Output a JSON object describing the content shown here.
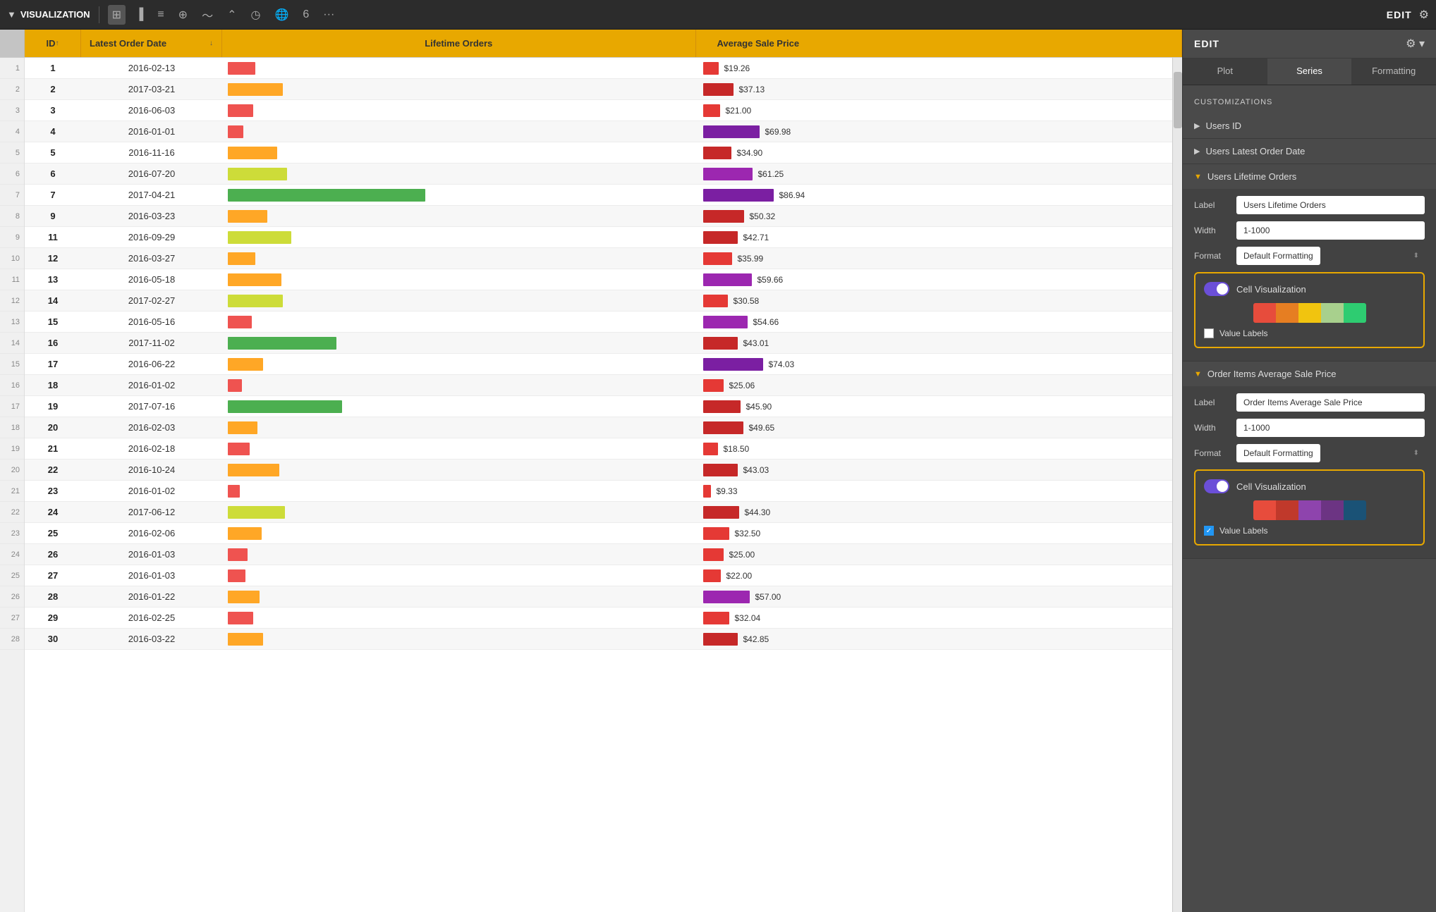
{
  "toolbar": {
    "title": "VISUALIZATION",
    "icons": [
      "▼",
      "⊞",
      "📊",
      "≡",
      "◉",
      "〜",
      "⌃",
      "🌐",
      "6",
      "···"
    ],
    "edit_label": "EDIT"
  },
  "tabs": {
    "plot": "Plot",
    "series": "Series",
    "formatting": "Formatting"
  },
  "table": {
    "headers": {
      "id": "ID",
      "date": "Latest Order Date",
      "orders": "Lifetime Orders",
      "price": "Average Sale Price"
    },
    "rows": [
      {
        "row": 1,
        "id": "1",
        "date": "2016-02-13",
        "orders": 14,
        "price": "$19.26",
        "price_val": 19.26
      },
      {
        "row": 2,
        "id": "2",
        "date": "2017-03-21",
        "orders": 28,
        "price": "$37.13",
        "price_val": 37.13
      },
      {
        "row": 3,
        "id": "3",
        "date": "2016-06-03",
        "orders": 13,
        "price": "$21.00",
        "price_val": 21.0
      },
      {
        "row": 4,
        "id": "4",
        "date": "2016-01-01",
        "orders": 8,
        "price": "$69.98",
        "price_val": 69.98
      },
      {
        "row": 5,
        "id": "5",
        "date": "2016-11-16",
        "orders": 25,
        "price": "$34.90",
        "price_val": 34.9
      },
      {
        "row": 6,
        "id": "6",
        "date": "2016-07-20",
        "orders": 30,
        "price": "$61.25",
        "price_val": 61.25
      },
      {
        "row": 7,
        "id": "7",
        "date": "2017-04-21",
        "orders": 100,
        "price": "$86.94",
        "price_val": 86.94
      },
      {
        "row": 8,
        "id": "9",
        "date": "2016-03-23",
        "orders": 20,
        "price": "$50.32",
        "price_val": 50.32
      },
      {
        "row": 9,
        "id": "11",
        "date": "2016-09-29",
        "orders": 32,
        "price": "$42.71",
        "price_val": 42.71
      },
      {
        "row": 10,
        "id": "12",
        "date": "2016-03-27",
        "orders": 14,
        "price": "$35.99",
        "price_val": 35.99
      },
      {
        "row": 11,
        "id": "13",
        "date": "2016-05-18",
        "orders": 27,
        "price": "$59.66",
        "price_val": 59.66
      },
      {
        "row": 12,
        "id": "14",
        "date": "2017-02-27",
        "orders": 28,
        "price": "$30.58",
        "price_val": 30.58
      },
      {
        "row": 13,
        "id": "15",
        "date": "2016-05-16",
        "orders": 12,
        "price": "$54.66",
        "price_val": 54.66
      },
      {
        "row": 14,
        "id": "16",
        "date": "2017-11-02",
        "orders": 55,
        "price": "$43.01",
        "price_val": 43.01
      },
      {
        "row": 15,
        "id": "17",
        "date": "2016-06-22",
        "orders": 18,
        "price": "$74.03",
        "price_val": 74.03
      },
      {
        "row": 16,
        "id": "18",
        "date": "2016-01-02",
        "orders": 7,
        "price": "$25.06",
        "price_val": 25.06
      },
      {
        "row": 17,
        "id": "19",
        "date": "2017-07-16",
        "orders": 58,
        "price": "$45.90",
        "price_val": 45.9
      },
      {
        "row": 18,
        "id": "20",
        "date": "2016-02-03",
        "orders": 15,
        "price": "$49.65",
        "price_val": 49.65
      },
      {
        "row": 19,
        "id": "21",
        "date": "2016-02-18",
        "orders": 11,
        "price": "$18.50",
        "price_val": 18.5
      },
      {
        "row": 20,
        "id": "22",
        "date": "2016-10-24",
        "orders": 26,
        "price": "$43.03",
        "price_val": 43.03
      },
      {
        "row": 21,
        "id": "23",
        "date": "2016-01-02",
        "orders": 6,
        "price": "$9.33",
        "price_val": 9.33
      },
      {
        "row": 22,
        "id": "24",
        "date": "2017-06-12",
        "orders": 29,
        "price": "$44.30",
        "price_val": 44.3
      },
      {
        "row": 23,
        "id": "25",
        "date": "2016-02-06",
        "orders": 17,
        "price": "$32.50",
        "price_val": 32.5
      },
      {
        "row": 24,
        "id": "26",
        "date": "2016-01-03",
        "orders": 10,
        "price": "$25.00",
        "price_val": 25.0
      },
      {
        "row": 25,
        "id": "27",
        "date": "2016-01-03",
        "orders": 9,
        "price": "$22.00",
        "price_val": 22.0
      },
      {
        "row": 26,
        "id": "28",
        "date": "2016-01-22",
        "orders": 16,
        "price": "$57.00",
        "price_val": 57.0
      },
      {
        "row": 27,
        "id": "29",
        "date": "2016-02-25",
        "orders": 13,
        "price": "$32.04",
        "price_val": 32.04
      },
      {
        "row": 28,
        "id": "30",
        "date": "2016-03-22",
        "orders": 18,
        "price": "$42.85",
        "price_val": 42.85
      }
    ]
  },
  "right_panel": {
    "edit_label": "EDIT",
    "customizations_label": "CUSTOMIZATIONS",
    "items": [
      {
        "id": "users-id",
        "title": "Users ID",
        "expanded": false
      },
      {
        "id": "users-latest",
        "title": "Users Latest Order Date",
        "expanded": false
      },
      {
        "id": "users-lifetime",
        "title": "Users Lifetime Orders",
        "expanded": true
      },
      {
        "id": "order-items",
        "title": "Order Items Average Sale Price",
        "expanded": true
      }
    ],
    "lifetime_orders": {
      "label_field": "Users Lifetime Orders",
      "width_field": "1-1000",
      "format_field": "Default Formatting",
      "cell_viz_label": "Cell Visualization",
      "value_labels": "Value Labels",
      "colors": [
        "#e74c3c",
        "#e67e22",
        "#f1c40f",
        "#a8d08d",
        "#2ecc71"
      ],
      "value_labels_checked": false
    },
    "avg_sale_price": {
      "label_field": "Order Items Average Sale Price",
      "width_field": "1-1000",
      "format_field": "Default Formatting",
      "cell_viz_label": "Cell Visualization",
      "value_labels": "Value Labels",
      "colors": [
        "#e74c3c",
        "#c0392b",
        "#8e44ad",
        "#6c3483",
        "#1a5276"
      ],
      "value_labels_checked": true
    }
  }
}
